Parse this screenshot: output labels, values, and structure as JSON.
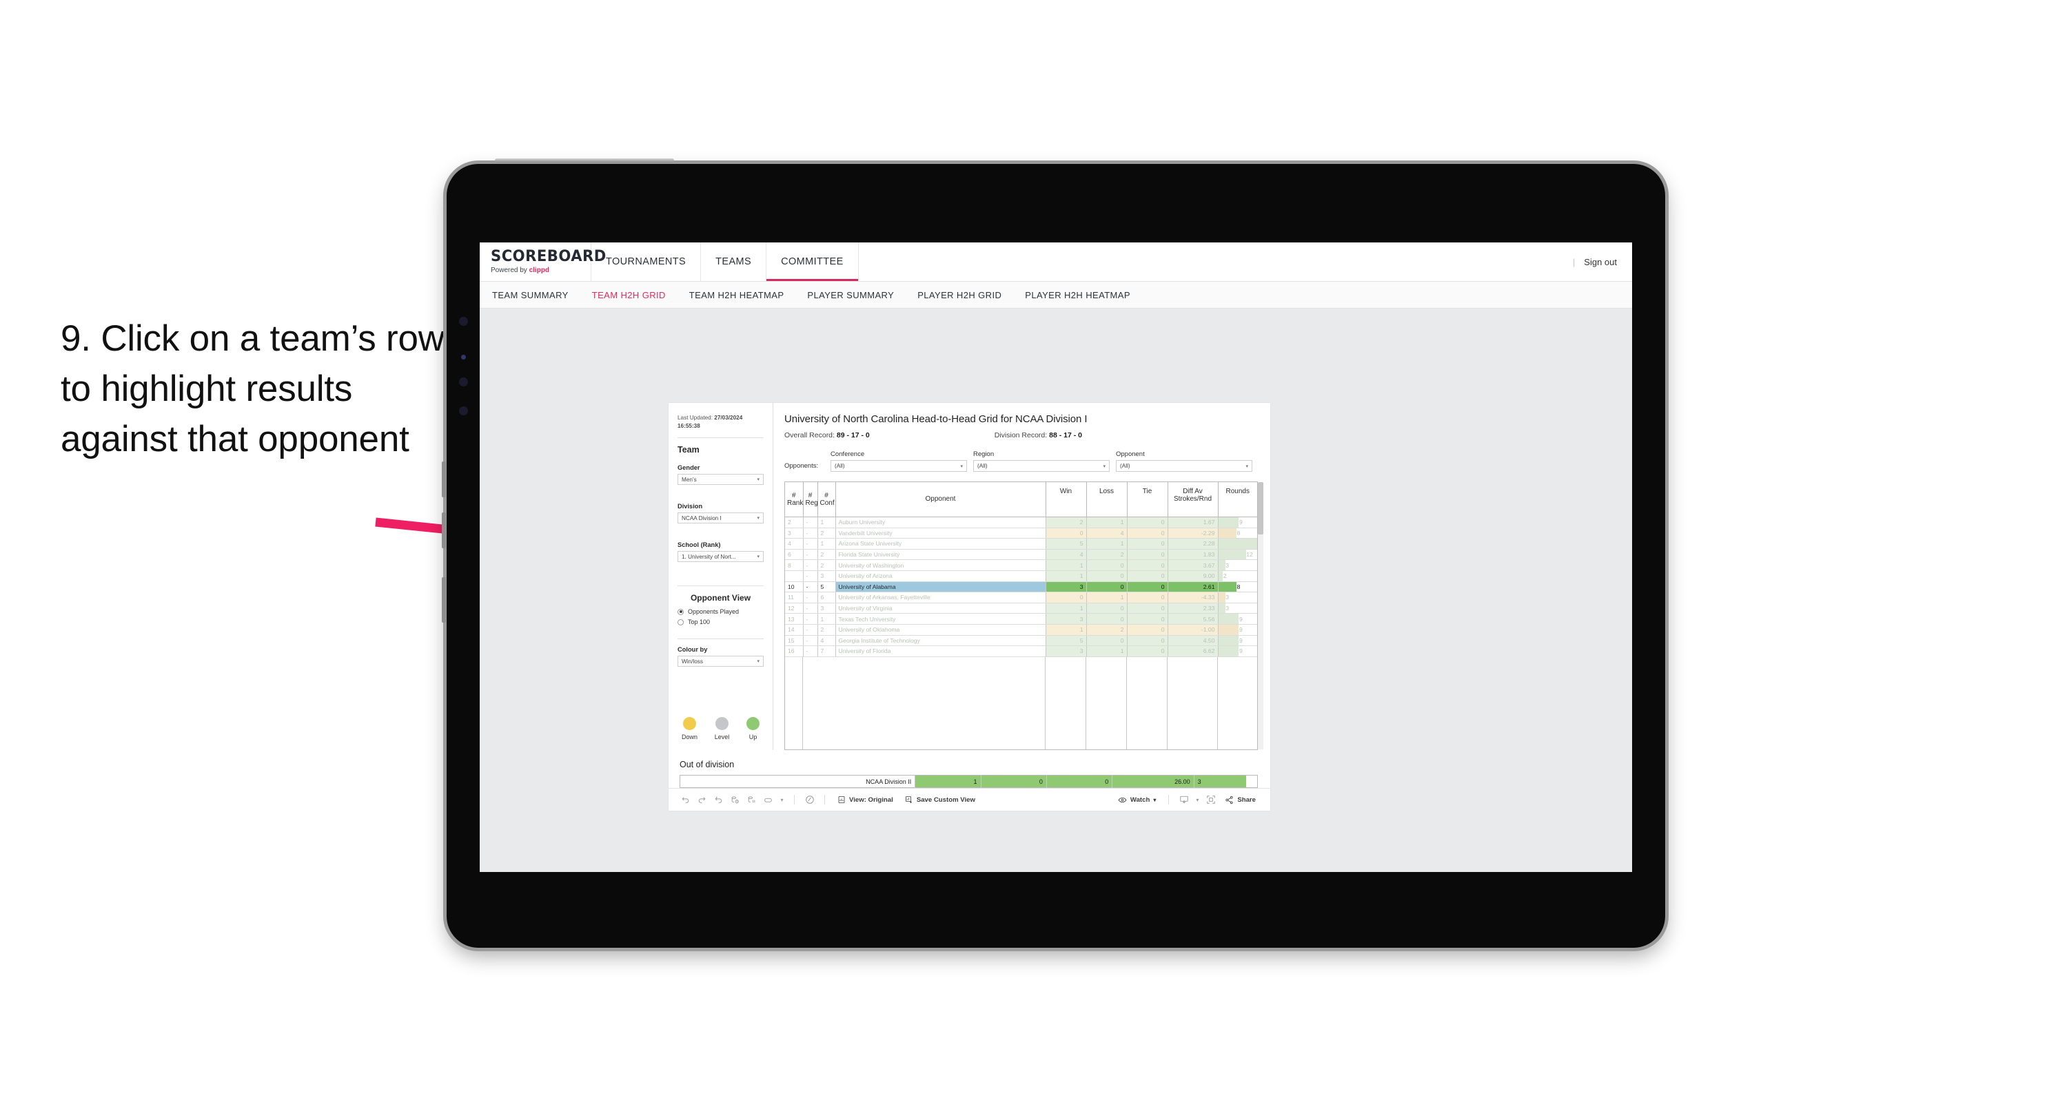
{
  "caption": {
    "text": "9. Click on a team’s row to highlight results against that opponent"
  },
  "brand": {
    "logo": "SCOREBOARD",
    "powered_prefix": "Powered by ",
    "powered_brand": "clippd",
    "accent": "#e8285c"
  },
  "topnav": {
    "items": [
      {
        "label": "TOURNAMENTS",
        "active": false
      },
      {
        "label": "TEAMS",
        "active": false
      },
      {
        "label": "COMMITTEE",
        "active": true
      }
    ],
    "divider": "|",
    "sign_out": "Sign out"
  },
  "subnav": {
    "items": [
      {
        "label": "TEAM SUMMARY",
        "active": false
      },
      {
        "label": "TEAM H2H GRID",
        "active": true
      },
      {
        "label": "TEAM H2H HEATMAP",
        "active": false
      },
      {
        "label": "PLAYER SUMMARY",
        "active": false
      },
      {
        "label": "PLAYER H2H GRID",
        "active": false
      },
      {
        "label": "PLAYER H2H HEATMAP",
        "active": false
      }
    ]
  },
  "panel": {
    "updated_label": "Last Updated: ",
    "updated_value": "27/03/2024 16:55:38",
    "team_heading": "Team",
    "gender_label": "Gender",
    "gender_value": "Men’s",
    "division_label": "Division",
    "division_value": "NCAA Division I",
    "school_label": "School (Rank)",
    "school_value": "1. University of Nort...",
    "opponent_view_heading": "Opponent View",
    "opponent_view_options": [
      {
        "label": "Opponents Played",
        "selected": true
      },
      {
        "label": "Top 100",
        "selected": false
      }
    ],
    "colour_by_label": "Colour by",
    "colour_by_value": "Win/loss",
    "legend": [
      {
        "label": "Down",
        "color": "#f2cb4a"
      },
      {
        "label": "Level",
        "color": "#c4c7c9"
      },
      {
        "label": "Up",
        "color": "#8fca72"
      }
    ]
  },
  "main": {
    "title": "University of North Carolina Head-to-Head Grid for NCAA Division I",
    "overall_record_label": "Overall Record: ",
    "overall_record_value": "89 - 17 - 0",
    "division_record_label": "Division Record: ",
    "division_record_value": "88 - 17 - 0",
    "filters_lead": "Opponents:",
    "filters": [
      {
        "label": "Conference",
        "value": "(All)"
      },
      {
        "label": "Region",
        "value": "(All)"
      },
      {
        "label": "Opponent",
        "value": "(All)"
      }
    ]
  },
  "chart_data": {
    "type": "table",
    "title": "University of North Carolina Head-to-Head Grid for NCAA Division I",
    "columns": [
      "# Rank",
      "# Reg",
      "# Conf",
      "Opponent",
      "Win",
      "Loss",
      "Tie",
      "Diff Av Strokes/Rnd",
      "Rounds"
    ],
    "header_lines": {
      "rank": [
        "#",
        "Rank"
      ],
      "reg": [
        "#",
        "Reg"
      ],
      "conf": [
        "#",
        "Conf"
      ],
      "opponent": [
        "Opponent"
      ],
      "win": [
        "Win"
      ],
      "loss": [
        "Loss"
      ],
      "tie": [
        "Tie"
      ],
      "diff": [
        "Diff Av",
        "Strokes/Rnd"
      ],
      "rounds": [
        "Rounds"
      ]
    },
    "rounds_max": 17,
    "rows": [
      {
        "rank": "2",
        "reg": "-",
        "conf": "1",
        "opponent": "Auburn University",
        "win": "2",
        "loss": "1",
        "tie": "0",
        "diff": "1.67",
        "rounds": "9",
        "tone": "up",
        "highlight": false
      },
      {
        "rank": "3",
        "reg": "-",
        "conf": "2",
        "opponent": "Vanderbilt University",
        "win": "0",
        "loss": "4",
        "tie": "0",
        "diff": "-2.29",
        "rounds": "8",
        "tone": "down",
        "highlight": false
      },
      {
        "rank": "4",
        "reg": "-",
        "conf": "1",
        "opponent": "Arizona State University",
        "win": "5",
        "loss": "1",
        "tie": "0",
        "diff": "2.28",
        "rounds": "17",
        "tone": "up",
        "highlight": false
      },
      {
        "rank": "6",
        "reg": "-",
        "conf": "2",
        "opponent": "Florida State University",
        "win": "4",
        "loss": "2",
        "tie": "0",
        "diff": "1.83",
        "rounds": "12",
        "tone": "up",
        "highlight": false
      },
      {
        "rank": "8",
        "reg": "-",
        "conf": "2",
        "opponent": "University of Washington",
        "win": "1",
        "loss": "0",
        "tie": "0",
        "diff": "3.67",
        "rounds": "3",
        "tone": "up",
        "highlight": false
      },
      {
        "rank": "",
        "reg": "-",
        "conf": "3",
        "opponent": "University of Arizona",
        "win": "1",
        "loss": "0",
        "tie": "0",
        "diff": "9.00",
        "rounds": "2",
        "tone": "up",
        "highlight": false
      },
      {
        "rank": "10",
        "reg": "-",
        "conf": "5",
        "opponent": "University of Alabama",
        "win": "3",
        "loss": "0",
        "tie": "0",
        "diff": "2.61",
        "rounds": "8",
        "tone": "up",
        "highlight": true
      },
      {
        "rank": "11",
        "reg": "-",
        "conf": "6",
        "opponent": "University of Arkansas, Fayetteville",
        "win": "0",
        "loss": "1",
        "tie": "0",
        "diff": "-4.33",
        "rounds": "3",
        "tone": "down",
        "highlight": false
      },
      {
        "rank": "12",
        "reg": "-",
        "conf": "3",
        "opponent": "University of Virginia",
        "win": "1",
        "loss": "0",
        "tie": "0",
        "diff": "2.33",
        "rounds": "3",
        "tone": "up",
        "highlight": false
      },
      {
        "rank": "13",
        "reg": "-",
        "conf": "1",
        "opponent": "Texas Tech University",
        "win": "3",
        "loss": "0",
        "tie": "0",
        "diff": "5.56",
        "rounds": "9",
        "tone": "up",
        "highlight": false
      },
      {
        "rank": "14",
        "reg": "-",
        "conf": "2",
        "opponent": "University of Oklahoma",
        "win": "1",
        "loss": "2",
        "tie": "0",
        "diff": "-1.00",
        "rounds": "9",
        "tone": "down",
        "highlight": false
      },
      {
        "rank": "15",
        "reg": "-",
        "conf": "4",
        "opponent": "Georgia Institute of Technology",
        "win": "5",
        "loss": "0",
        "tie": "0",
        "diff": "4.50",
        "rounds": "9",
        "tone": "up",
        "highlight": false
      },
      {
        "rank": "16",
        "reg": "-",
        "conf": "7",
        "opponent": "University of Florida",
        "win": "3",
        "loss": "1",
        "tie": "0",
        "diff": "6.62",
        "rounds": "9",
        "tone": "up",
        "highlight": false
      }
    ]
  },
  "out_of_division": {
    "heading": "Out of division",
    "row": {
      "name": "NCAA Division II",
      "win": "1",
      "loss": "0",
      "tie": "0",
      "diff": "26.00",
      "rounds": "3"
    }
  },
  "toolbar": {
    "view_label": "View: Original",
    "save_label": "Save Custom View",
    "watch_label": "Watch",
    "share_label": "Share"
  }
}
